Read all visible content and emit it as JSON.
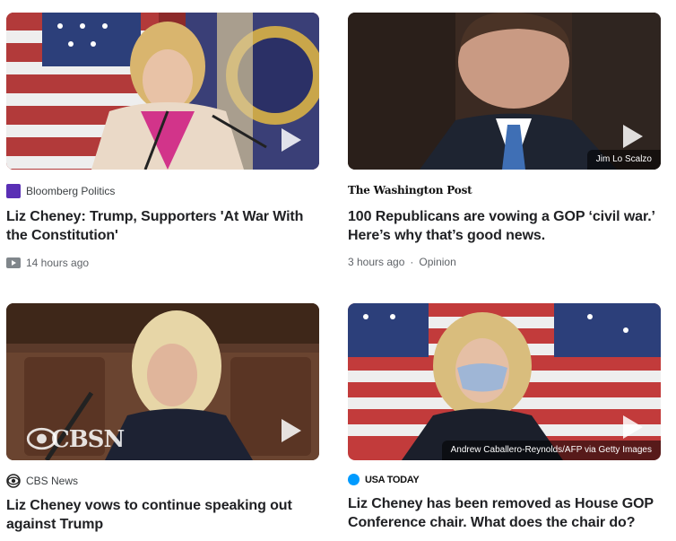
{
  "cards": [
    {
      "source": "Bloomberg Politics",
      "headline": "Liz Cheney: Trump, Supporters 'At War With the Constitution'",
      "meta": "14 hours ago",
      "has_video_icon": true
    },
    {
      "source": "The Washington Post",
      "headline": "100 Republicans are vowing a GOP ‘civil war.’ Here’s why that’s good news.",
      "meta": "3 hours ago",
      "meta_label": "Opinion",
      "credit": "Jim Lo Scalzo"
    },
    {
      "source": "CBS News",
      "headline": "Liz Cheney vows to continue speaking out against Trump",
      "thumb_watermark": "CBSN"
    },
    {
      "source": "USA TODAY",
      "headline": "Liz Cheney has been removed as House GOP Conference chair. What does the chair do?",
      "credit": "Andrew Caballero-Reynolds/AFP via Getty Images"
    }
  ],
  "icons": {
    "play": "play-icon",
    "video": "video-icon",
    "bloomberg": "bloomberg-logo-icon",
    "cbs": "cbs-eye-logo-icon",
    "usatoday": "usatoday-dot-icon"
  },
  "colors": {
    "bloomberg": "#5a2fb5",
    "usatoday": "#009bff",
    "meta_text": "#5f6368"
  }
}
